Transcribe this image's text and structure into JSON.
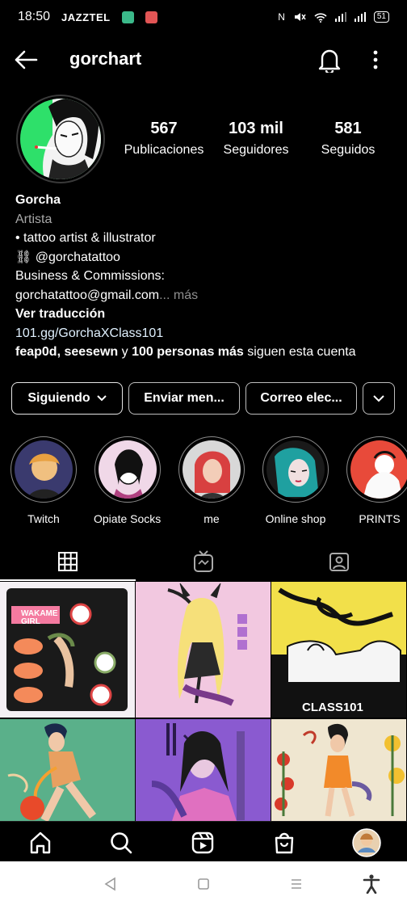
{
  "status_bar": {
    "time": "18:50",
    "carrier": "JAZZTEL",
    "icons": [
      "nfc-icon",
      "mute-icon",
      "wifi-icon",
      "signal-icon",
      "signal-icon"
    ],
    "battery": "51"
  },
  "header": {
    "username": "gorchart"
  },
  "profile": {
    "stats": [
      {
        "value": "567",
        "label": "Publicaciones"
      },
      {
        "value": "103 mil",
        "label": "Seguidores"
      },
      {
        "value": "581",
        "label": "Seguidos"
      }
    ],
    "name": "Gorcha",
    "category": "Artista",
    "bio_line1": "• tattoo artist & illustrator",
    "bio_line2": "⛓ @gorchatattoo",
    "bio_line3": "Business & Commissions:",
    "bio_line4": "gorchatattoo@gmail.com",
    "more": "... más",
    "translate": "Ver traducción",
    "link": "101.gg/GorchaXClass101",
    "followed_by_names": "feap0d, seesewn",
    "followed_by_and": " y ",
    "followed_by_count": "100 personas más",
    "followed_by_suffix": " siguen esta cuenta"
  },
  "buttons": {
    "following": "Siguiendo",
    "message": "Enviar men...",
    "email": "Correo elec..."
  },
  "highlights": [
    {
      "label": "Twitch"
    },
    {
      "label": "Opiate Socks!..."
    },
    {
      "label": "me"
    },
    {
      "label": "Online shop"
    },
    {
      "label": "PRINTS"
    }
  ],
  "grid": {
    "post1_text1": "WAKAME",
    "post1_text2": "GIRL",
    "post3_text": "CLASS101"
  },
  "colors": {
    "background": "#000000",
    "text": "#ffffff",
    "muted": "#a8a8a8",
    "button_border": "#bdbdbd",
    "avatar_bg": "#2ee06a"
  }
}
